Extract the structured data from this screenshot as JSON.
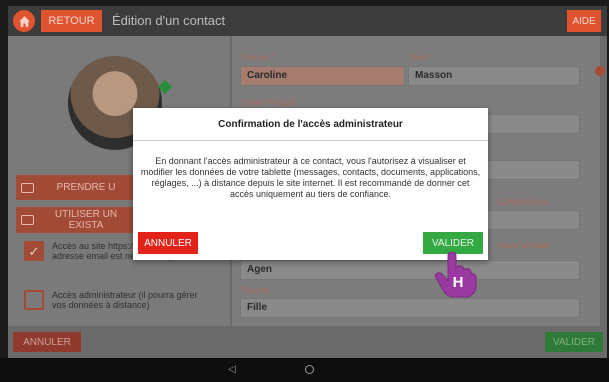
{
  "topbar": {
    "back_label": "RETOUR",
    "title": "Édition d'un contact",
    "help_label": "AIDE"
  },
  "left": {
    "take_photo_label": "PRENDRE U",
    "use_existing_label_1": "UTILISER UN",
    "use_existing_label_2": "EXISTA",
    "site_access_label": "Accès au site https://mon.ardoiz.fr (une adresse email est nécessaire)",
    "admin_access_label": "Accès administrateur (il pourra gérer vos données à distance)"
  },
  "form": {
    "first_name_label": "Prénom *",
    "first_name_value": "Caroline",
    "last_name_label": "Nom *",
    "last_name_value": "Masson",
    "email_label": "Email Principal",
    "date_hint": "(JJ/MM/AAAA)",
    "mobile_label": "phone portable",
    "city_value": "Agen",
    "relation_label": "Parenté",
    "relation_value": "Fille"
  },
  "bottombar": {
    "cancel_label": "ANNULER",
    "validate_label": "VALIDER"
  },
  "modal": {
    "title": "Confirmation de l'accès administrateur",
    "body": "En donnant l'accès administrateur à ce contact, vous l'autorisez à visualiser et modifier les données de votre tablette (messages, contacts, documents, applications, réglages, ...) à distance depuis le site internet. Il est recommandé de donner cet accès uniquement au tiers de confiance.",
    "cancel_label": "ANNULER",
    "validate_label": "VALIDER"
  },
  "colors": {
    "accent": "#e0532f",
    "cancel_red": "#e2231a",
    "validate_green": "#34a843"
  }
}
